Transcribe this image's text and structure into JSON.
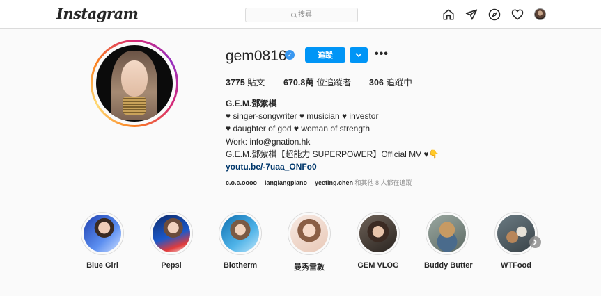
{
  "topbar": {
    "logo": "Instagram",
    "search_placeholder": "搜尋",
    "icons": [
      "home-icon",
      "direct-send-icon",
      "explore-compass-icon",
      "activity-heart-icon",
      "profile-avatar"
    ]
  },
  "profile": {
    "username": "gem0816",
    "verified": true,
    "follow_label": "追蹤",
    "posts_count": "3775",
    "posts_label": "貼文",
    "followers_count": "670.8萬",
    "followers_label": "位追蹤者",
    "following_count": "306",
    "following_label": "追蹤中"
  },
  "bio": {
    "name": "G.E.M.鄧紫棋",
    "line1": "♥ singer-songwriter ♥ musician ♥ investor",
    "line2": "♥ daughter of god ♥ woman of strength",
    "line3": "Work: info@gnation.hk",
    "line4": "G.E.M.鄧紫棋【超能力 SUPERPOWER】Official MV ♥👇",
    "link": "youtu.be/-7uaa_ONFo0"
  },
  "followed_by": {
    "accounts": [
      "c.o.c.oooo",
      "langlangpiano",
      "yeeting.chen"
    ],
    "suffix": "和其他 8 人都在追蹤"
  },
  "highlights": [
    {
      "label": "Blue Girl"
    },
    {
      "label": "Pepsi"
    },
    {
      "label": "Biotherm"
    },
    {
      "label": "曼秀雷敦"
    },
    {
      "label": "GEM VLOG"
    },
    {
      "label": "Buddy Butter"
    },
    {
      "label": "WTFood"
    }
  ],
  "colors": {
    "accent": "#0095f6",
    "verified": "#3897f0",
    "link": "#00376b",
    "muted": "#8e8e8e",
    "border": "#dbdbdb",
    "background": "#fafafa"
  }
}
